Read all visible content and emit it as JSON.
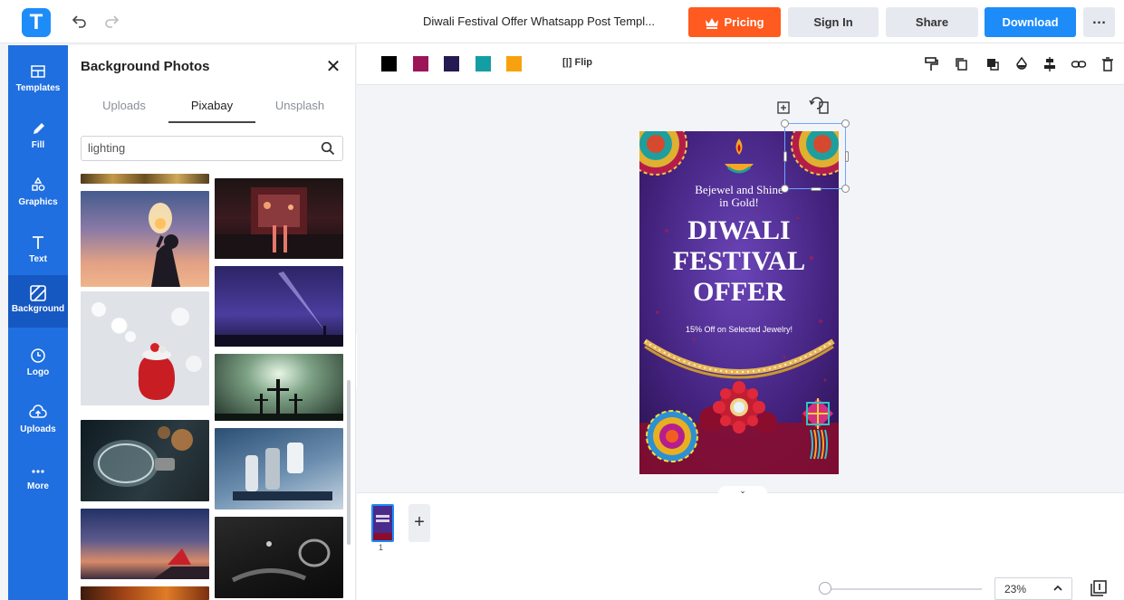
{
  "app": {
    "logo_letter": "T"
  },
  "header": {
    "title": "Diwali Festival Offer Whatsapp Post Templ...",
    "pricing_label": "Pricing",
    "signin_label": "Sign In",
    "share_label": "Share",
    "download_label": "Download",
    "more_label": "…"
  },
  "nav": {
    "items": [
      {
        "label": "Templates",
        "icon": "templates-icon"
      },
      {
        "label": "Fill",
        "icon": "pencil-icon"
      },
      {
        "label": "Graphics",
        "icon": "shapes-icon"
      },
      {
        "label": "Text",
        "icon": "text-icon"
      },
      {
        "label": "Background",
        "icon": "background-icon",
        "active": true
      },
      {
        "label": "Logo",
        "icon": "logo-icon"
      },
      {
        "label": "Uploads",
        "icon": "cloud-upload-icon"
      },
      {
        "label": "More",
        "icon": "more-icon"
      }
    ]
  },
  "panel": {
    "title": "Background Photos",
    "close_label": "✕",
    "tabs": [
      {
        "label": "Uploads"
      },
      {
        "label": "Pixabay",
        "selected": true
      },
      {
        "label": "Unsplash"
      }
    ],
    "search_value": "lighting"
  },
  "toolbar": {
    "swatches": [
      "#000000",
      "#9c1556",
      "#251a52",
      "#139ea3",
      "#f8a10e"
    ],
    "flip_label": "Flip"
  },
  "poster": {
    "tagline_1": "Bejewel and Shine",
    "tagline_2": "in Gold!",
    "headline_1": "DIWALI",
    "headline_2": "FESTIVAL",
    "headline_3": "OFFER",
    "offer_text": "15% Off on Selected Jewelry!"
  },
  "pages": {
    "current": "1",
    "add_label": "+"
  },
  "zoom": {
    "level": "23%",
    "fraction": 0.0
  },
  "colors": {
    "accent": "#1d8cf8",
    "pricing": "#ff5a1f",
    "nav": "#1f6fe0"
  }
}
